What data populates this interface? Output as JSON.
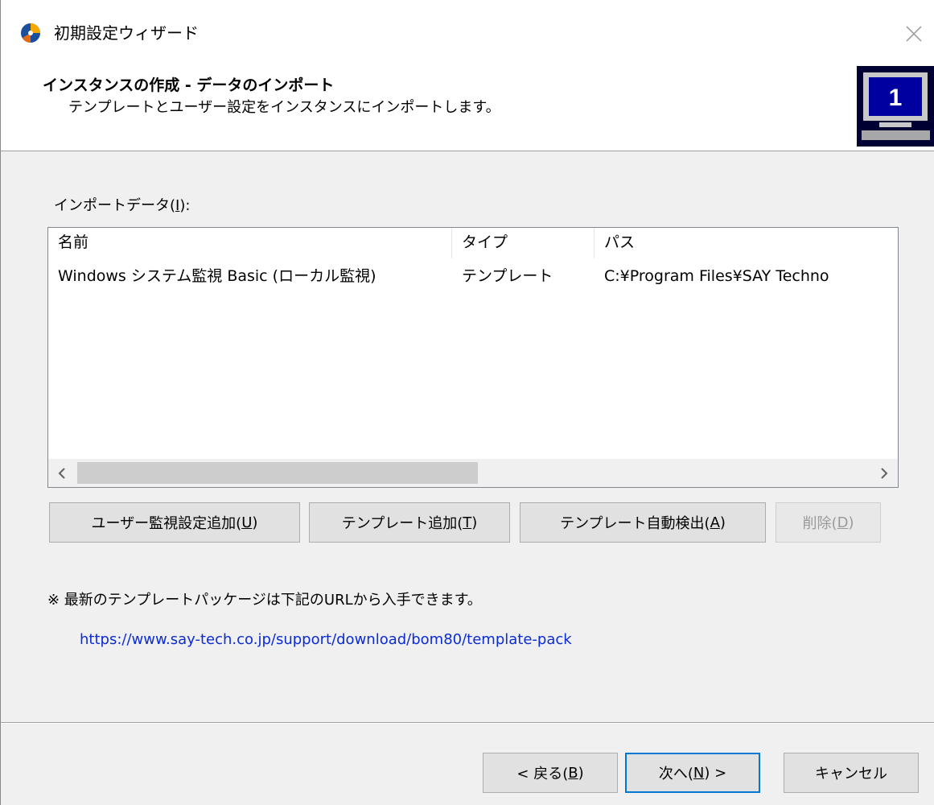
{
  "window": {
    "title": "初期設定ウィザード",
    "colors": {
      "background": "#f0f0f0",
      "accent": "#0078d7",
      "link": "#0b2bd6"
    }
  },
  "header": {
    "title": "インスタンスの作成 - データのインポート",
    "subtitle": "テンプレートとユーザー設定をインスタンスにインポートします。",
    "graphic_digit": "1"
  },
  "import_list": {
    "label_prefix": "インポートデータ(",
    "label_accel": "I",
    "label_suffix": "):",
    "columns": [
      "名前",
      "タイプ",
      "パス"
    ],
    "rows": [
      [
        "Windows システム監視 Basic (ローカル監視)",
        "テンプレート",
        "C:¥Program Files¥SAY Techno"
      ]
    ]
  },
  "buttons": {
    "add_user": {
      "text": "ユーザー監視設定追加(",
      "accel": "U",
      "close": ")"
    },
    "add_template": {
      "text": "テンプレート追加(",
      "accel": "T",
      "close": ")"
    },
    "auto_detect": {
      "text": "テンプレート自動検出(",
      "accel": "A",
      "close": ")"
    },
    "delete": {
      "text": "削除(",
      "accel": "D",
      "close": ")"
    }
  },
  "note": "※ 最新のテンプレートパッケージは下記のURLから入手できます。",
  "url": "https://www.say-tech.co.jp/support/download/bom80/template-pack",
  "footer": {
    "back": {
      "text": "< 戻る(",
      "accel": "B",
      "close": ")"
    },
    "next": {
      "text": "次へ(",
      "accel": "N",
      "close": ") >"
    },
    "cancel": "キャンセル"
  }
}
